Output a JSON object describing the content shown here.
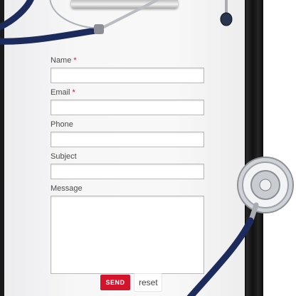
{
  "form": {
    "name_label": "Name",
    "email_label": "Email",
    "phone_label": "Phone",
    "subject_label": "Subject",
    "message_label": "Message",
    "required_marker": "*",
    "send_label": "SEND",
    "reset_label": "reset"
  },
  "colors": {
    "accent": "#d4142c",
    "required": "#d0102e",
    "tubing": "#1c2a5c"
  }
}
